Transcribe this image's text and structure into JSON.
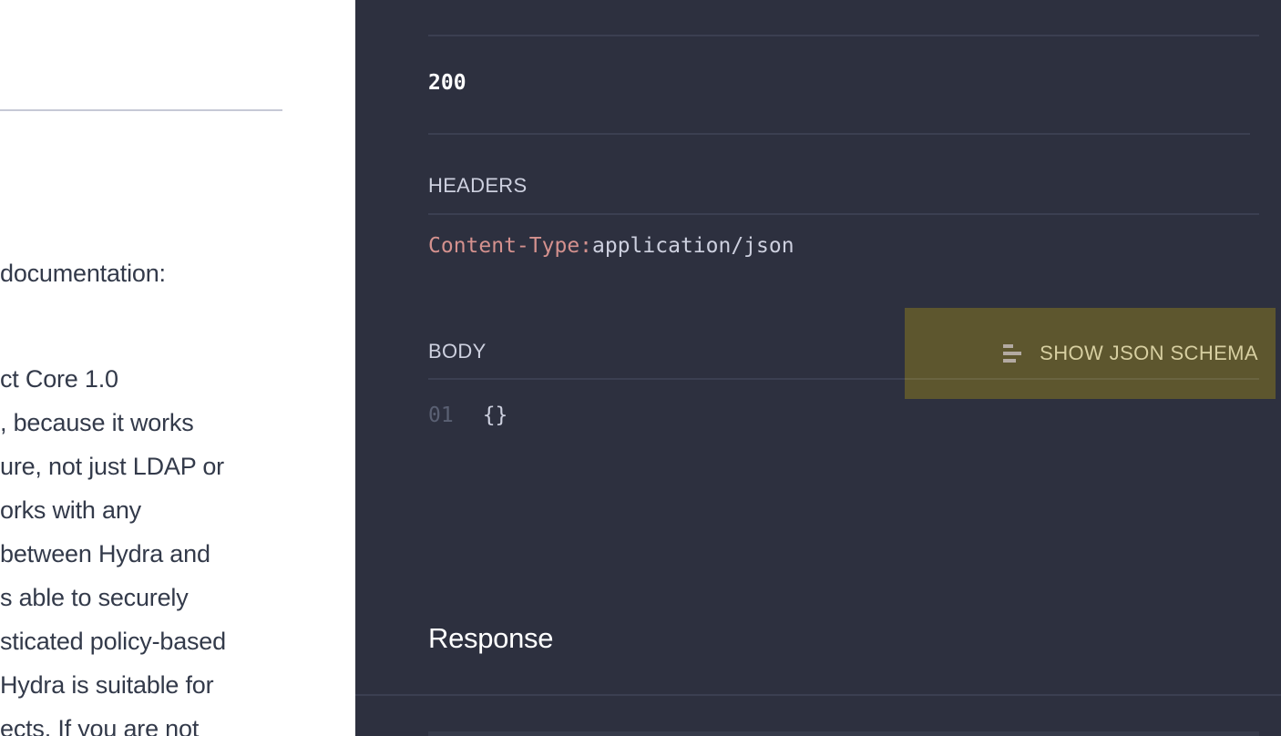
{
  "left_panel": {
    "text_lines": [
      "documentation:",
      "ct Core 1.0",
      ", because it works",
      "ure, not just LDAP or",
      "orks with any",
      " between Hydra and",
      "s able to securely",
      "sticated policy-based",
      "Hydra is suitable for",
      "ects. If you are not"
    ]
  },
  "code_panel": {
    "status_code": "200",
    "headers_label": "HEADERS",
    "headers": [
      {
        "key": "Content-Type:",
        "value": "application/json"
      }
    ],
    "body_label": "BODY",
    "show_schema_button": {
      "label": "SHOW JSON SCHEMA",
      "icon": "schema-lines-icon"
    },
    "body_lines": [
      {
        "number": "01",
        "text": "{}"
      }
    ],
    "response_title": "Response"
  },
  "colors": {
    "panel_background": "#2d303f",
    "header_key": "#d4918e",
    "highlight": "#5d562e"
  }
}
